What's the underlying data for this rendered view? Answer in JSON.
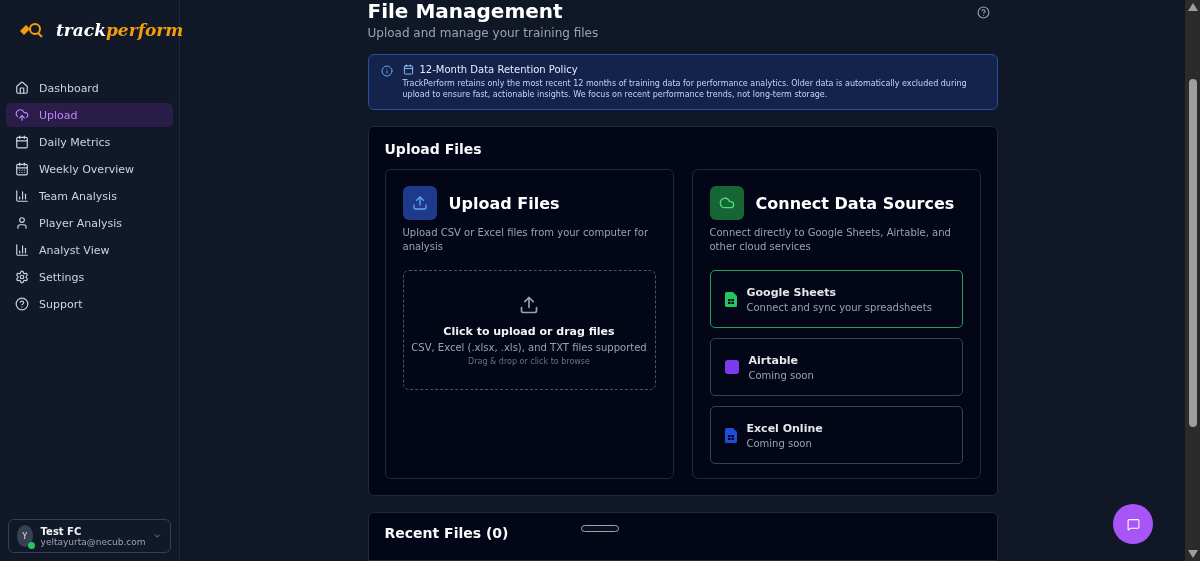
{
  "brand": {
    "part_1": "track",
    "part_2": "perform"
  },
  "sidebar": {
    "items": [
      {
        "label": "Dashboard",
        "selected": false
      },
      {
        "label": "Upload",
        "selected": true
      },
      {
        "label": "Daily Metrics",
        "selected": false
      },
      {
        "label": "Weekly Overview",
        "selected": false
      },
      {
        "label": "Team Analysis",
        "selected": false
      },
      {
        "label": "Player Analysis",
        "selected": false
      },
      {
        "label": "Analyst View",
        "selected": false
      },
      {
        "label": "Settings",
        "selected": false
      },
      {
        "label": "Support",
        "selected": false
      }
    ],
    "user": {
      "initial": "Y",
      "name": "Test FC",
      "email": "yeltayurta@necub.com",
      "online": true
    }
  },
  "page": {
    "title": "File Management",
    "subtitle": "Upload and manage your training files"
  },
  "notice": {
    "title": "12-Month Data Retention Policy",
    "text": "TrackPerform retains only the most recent 12 months of training data for performance analytics. Older data is automatically excluded during upload to ensure fast, actionable insights. We focus on recent performance trends, not long-term storage."
  },
  "upload_section": {
    "title": "Upload Files",
    "upload_panel": {
      "title": "Upload Files",
      "description": "Upload CSV or Excel files from your computer for analysis",
      "drop_title": "Click to upload or drag files",
      "drop_formats": "CSV, Excel (.xlsx, .xls), and TXT files supported",
      "drop_hint": "Drag & drop or click to browse"
    },
    "sources_panel": {
      "title": "Connect Data Sources",
      "description": "Connect directly to Google Sheets, Airtable, and other cloud services",
      "sources": [
        {
          "name": "Google Sheets",
          "status": "Connect and sync your spreadsheets",
          "selected": true,
          "color": "#22c55e"
        },
        {
          "name": "Airtable",
          "status": "Coming soon",
          "selected": false,
          "color": "#7c3aed"
        },
        {
          "name": "Excel Online",
          "status": "Coming soon",
          "selected": false,
          "color": "#1d4ed8"
        }
      ]
    }
  },
  "recent_files": {
    "title": "Recent Files (0)"
  }
}
